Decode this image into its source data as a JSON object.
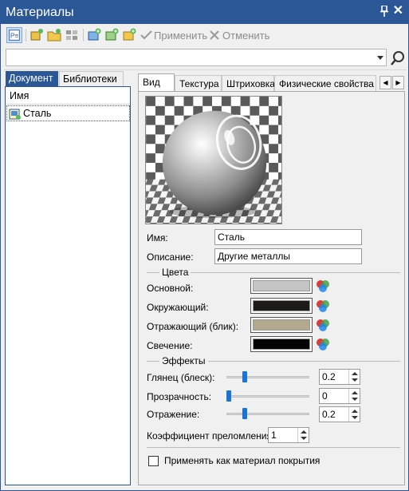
{
  "window": {
    "title": "Материалы"
  },
  "toolbar": {
    "apply_label": "Применить",
    "cancel_label": "Отменить"
  },
  "search": {
    "value": "",
    "placeholder": ""
  },
  "left_tabs": [
    {
      "label": "Документ",
      "active": true
    },
    {
      "label": "Библиотеки",
      "active": false
    }
  ],
  "list": {
    "header": "Имя",
    "items": [
      {
        "label": "Сталь",
        "selected": true
      }
    ]
  },
  "right_tabs": [
    {
      "label": "Вид",
      "active": true
    },
    {
      "label": "Текстура",
      "active": false
    },
    {
      "label": "Штриховка",
      "active": false
    },
    {
      "label": "Физические свойства",
      "active": false
    }
  ],
  "form": {
    "name_label": "Имя:",
    "name_value": "Сталь",
    "desc_label": "Описание:",
    "desc_value": "Другие металлы",
    "colors_section": "Цвета",
    "colors": [
      {
        "label": "Основной:",
        "color": "#c5c5c5"
      },
      {
        "label": "Окружающий:",
        "color": "#1c1a17"
      },
      {
        "label": "Отражающий (блик):",
        "color": "#b3a98e"
      },
      {
        "label": "Свечение:",
        "color": "#050505"
      }
    ],
    "effects_section": "Эффекты",
    "effects": [
      {
        "label": "Глянец (блеск):",
        "value": "0.2",
        "level": 0.2
      },
      {
        "label": "Прозрачность:",
        "value": "0",
        "level": 0
      },
      {
        "label": "Отражение:",
        "value": "0.2",
        "level": 0.2
      }
    ],
    "refraction_label": "Коэффициент преломления:",
    "refraction_value": "1",
    "coating_label": "Применять как материал покрытия",
    "coating_checked": false
  }
}
